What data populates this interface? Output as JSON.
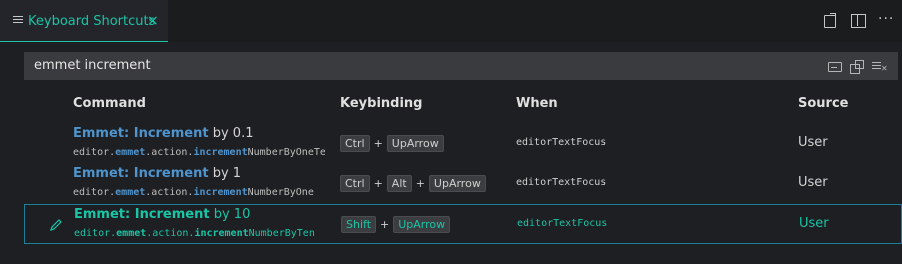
{
  "tab": {
    "title": "Keyboard Shortcuts",
    "close": "×",
    "icon": "keyboard-shortcuts-icon"
  },
  "actions": [
    "open-json-icon",
    "split-editor-icon",
    "more-actions-icon"
  ],
  "actions_more": "···",
  "search": {
    "value": "emmet increment",
    "icons": [
      "keyboard-icon",
      "record-keys-icon",
      "clear-filter-icon"
    ]
  },
  "columns": {
    "command": "Command",
    "keybinding": "Keybinding",
    "when": "When",
    "source": "Source"
  },
  "rows": [
    {
      "title_prefix": "Emmet: Increment",
      "title_suffix": " by 0.1",
      "id_parts": [
        "editor.",
        "emmet",
        ".action.",
        "increment",
        "NumberByOneTenth"
      ],
      "keys": [
        "Ctrl",
        "UpArrow"
      ],
      "when": "editorTextFocus",
      "source": "User"
    },
    {
      "title_prefix": "Emmet: Increment",
      "title_suffix": " by 1",
      "id_parts": [
        "editor.",
        "emmet",
        ".action.",
        "increment",
        "NumberByOne"
      ],
      "keys": [
        "Ctrl",
        "Alt",
        "UpArrow"
      ],
      "when": "editorTextFocus",
      "source": "User"
    },
    {
      "title_prefix": "Emmet: Increment",
      "title_suffix": " by 10",
      "id_parts": [
        "editor.",
        "emmet",
        ".action.",
        "increment",
        "NumberByTen"
      ],
      "keys": [
        "Shift",
        "UpArrow"
      ],
      "when": "editorTextFocus",
      "source": "User"
    }
  ],
  "plus": "+",
  "colors": {
    "accent": "#1ac4a6",
    "highlight": "#4e94ce",
    "selected_border": "#1a7f9a"
  }
}
